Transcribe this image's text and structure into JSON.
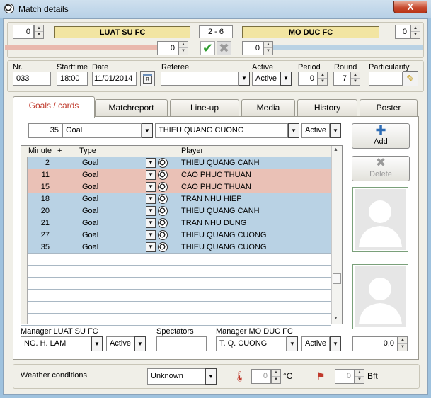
{
  "window": {
    "title": "Match details",
    "close": "X"
  },
  "score": {
    "home_left_value": "0",
    "home_team": "LUAT SU FC",
    "result": "2  - 6",
    "away_team": "MO DUC FC",
    "away_right_value": "0",
    "home_sub_value": "0",
    "away_sub_value": "0"
  },
  "info": {
    "nr_label": "Nr.",
    "nr_value": "033",
    "starttime_label": "Starttime",
    "starttime_value": "18:00",
    "date_label": "Date",
    "date_value": "11/01/2014",
    "referee_label": "Referee",
    "referee_value": "",
    "active_label": "Active",
    "active_value": "Active",
    "period_label": "Period",
    "period_value": "0",
    "round_label": "Round",
    "round_value": "7",
    "particularity_label": "Particularity",
    "particularity_value": ""
  },
  "tabs": [
    "Goals / cards",
    "Matchreport",
    "Line-up",
    "Media",
    "History",
    "Poster"
  ],
  "entry": {
    "minute": "35",
    "type": "Goal",
    "player": "THIEU QUANG CUONG",
    "status": "Active"
  },
  "table": {
    "headers": {
      "minute": "Minute",
      "plus": "+",
      "type": "Type",
      "player": "Player"
    },
    "rows": [
      {
        "minute": "2",
        "type": "Goal",
        "player": "THIEU QUANG CANH",
        "team": "blue"
      },
      {
        "minute": "11",
        "type": "Goal",
        "player": "CAO PHUC THUAN",
        "team": "pink"
      },
      {
        "minute": "15",
        "type": "Goal",
        "player": "CAO PHUC THUAN",
        "team": "pink"
      },
      {
        "minute": "18",
        "type": "Goal",
        "player": "TRAN NHU HIEP",
        "team": "blue"
      },
      {
        "minute": "20",
        "type": "Goal",
        "player": "THIEU QUANG CANH",
        "team": "blue"
      },
      {
        "minute": "21",
        "type": "Goal",
        "player": "TRAN NHU DUNG",
        "team": "blue"
      },
      {
        "minute": "27",
        "type": "Goal",
        "player": "THIEU QUANG CUONG",
        "team": "blue"
      },
      {
        "minute": "35",
        "type": "Goal",
        "player": "THIEU QUANG CUONG",
        "team": "blue"
      }
    ]
  },
  "buttons": {
    "add": "Add",
    "delete": "Delete"
  },
  "rating_value": "0,0",
  "managers": {
    "home_label": "Manager LUAT SU FC",
    "home_value": "NG. H. LAM",
    "home_status": "Active",
    "spectators_label": "Spectators",
    "spectators_value": "",
    "away_label": "Manager MO DUC FC",
    "away_value": "T. Q. CUONG",
    "away_status": "Active"
  },
  "weather": {
    "label": "Weather conditions",
    "value": "Unknown",
    "temp_value": "0",
    "temp_unit": "°C",
    "wind_value": "0",
    "wind_unit": "Bft"
  },
  "colors": {
    "home_row": "#eac1b6",
    "away_row": "#b9d2e4",
    "active_tab": "#c0392b",
    "team_bar": "#f2e5a2"
  }
}
